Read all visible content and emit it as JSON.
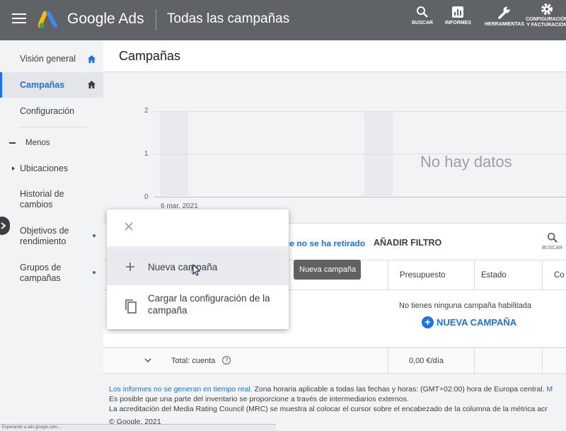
{
  "topbar": {
    "brand": "Google Ads",
    "title": "Todas las campañas",
    "buttons": [
      {
        "label": "BUSCAR",
        "icon": "search-icon"
      },
      {
        "label": "INFORMES",
        "icon": "reports-icon"
      },
      {
        "label": "HERRAMIENTAS",
        "icon": "wrench-icon"
      },
      {
        "label": "CONFIGURACIÓN Y FACTURACIÓN",
        "icon": "gear-icon"
      }
    ]
  },
  "sidebar": {
    "items": [
      {
        "label": "Visión general"
      },
      {
        "label": "Campañas"
      },
      {
        "label": "Configuración"
      }
    ],
    "less_label": "Menos",
    "sub_items": [
      {
        "label": "Ubicaciones"
      },
      {
        "label": "Historial de cambios"
      },
      {
        "label": "Objetivos de rendimiento"
      },
      {
        "label": "Grupos de campañas"
      }
    ]
  },
  "main": {
    "page_title": "Campañas",
    "chart": {
      "y_ticks": [
        "2",
        "1",
        "0"
      ],
      "x_label": "6 mar. 2021",
      "no_data": "No hay datos"
    },
    "toolbar": {
      "filter_text": "ue no se ha retirado",
      "add_filter": "AÑADIR FILTRO",
      "search_label": "BUSCAR"
    },
    "table": {
      "columns": [
        "Presupuesto",
        "Estado",
        "Co"
      ],
      "empty_message": "No tienes ninguna campaña habilitada",
      "new_campaign": "NUEVA CAMPAÑA"
    },
    "total": {
      "label": "Total: cuenta",
      "help": "?",
      "budget": "0,00 €/día"
    },
    "footer": {
      "link": "Los informes no se generan en tiempo real.",
      "line1_rest": " Zona horaria aplicable a todas las fechas y horas: (GMT+02:00) hora de Europa central.",
      "line1_link2": " M",
      "line2": "Es posible que una parte del inventario se proporcione a través de intermediarios externos.",
      "line3": "La acreditación del Media Rating Council (MRC) se muestra al colocar el cursor sobre el encabezado de la columna de la métrica acr",
      "copyright": "© Google, 2021"
    }
  },
  "popup": {
    "items": [
      {
        "label": "Nueva campaña",
        "icon": "plus-icon"
      },
      {
        "label": "Cargar la configuración de la campaña",
        "icon": "copy-icon"
      }
    ],
    "tooltip": "Nueva campaña"
  },
  "status_bar": "Esperando a ads.google.com...",
  "colors": {
    "topbar": "#5f6368",
    "accent": "#1a73e8"
  }
}
